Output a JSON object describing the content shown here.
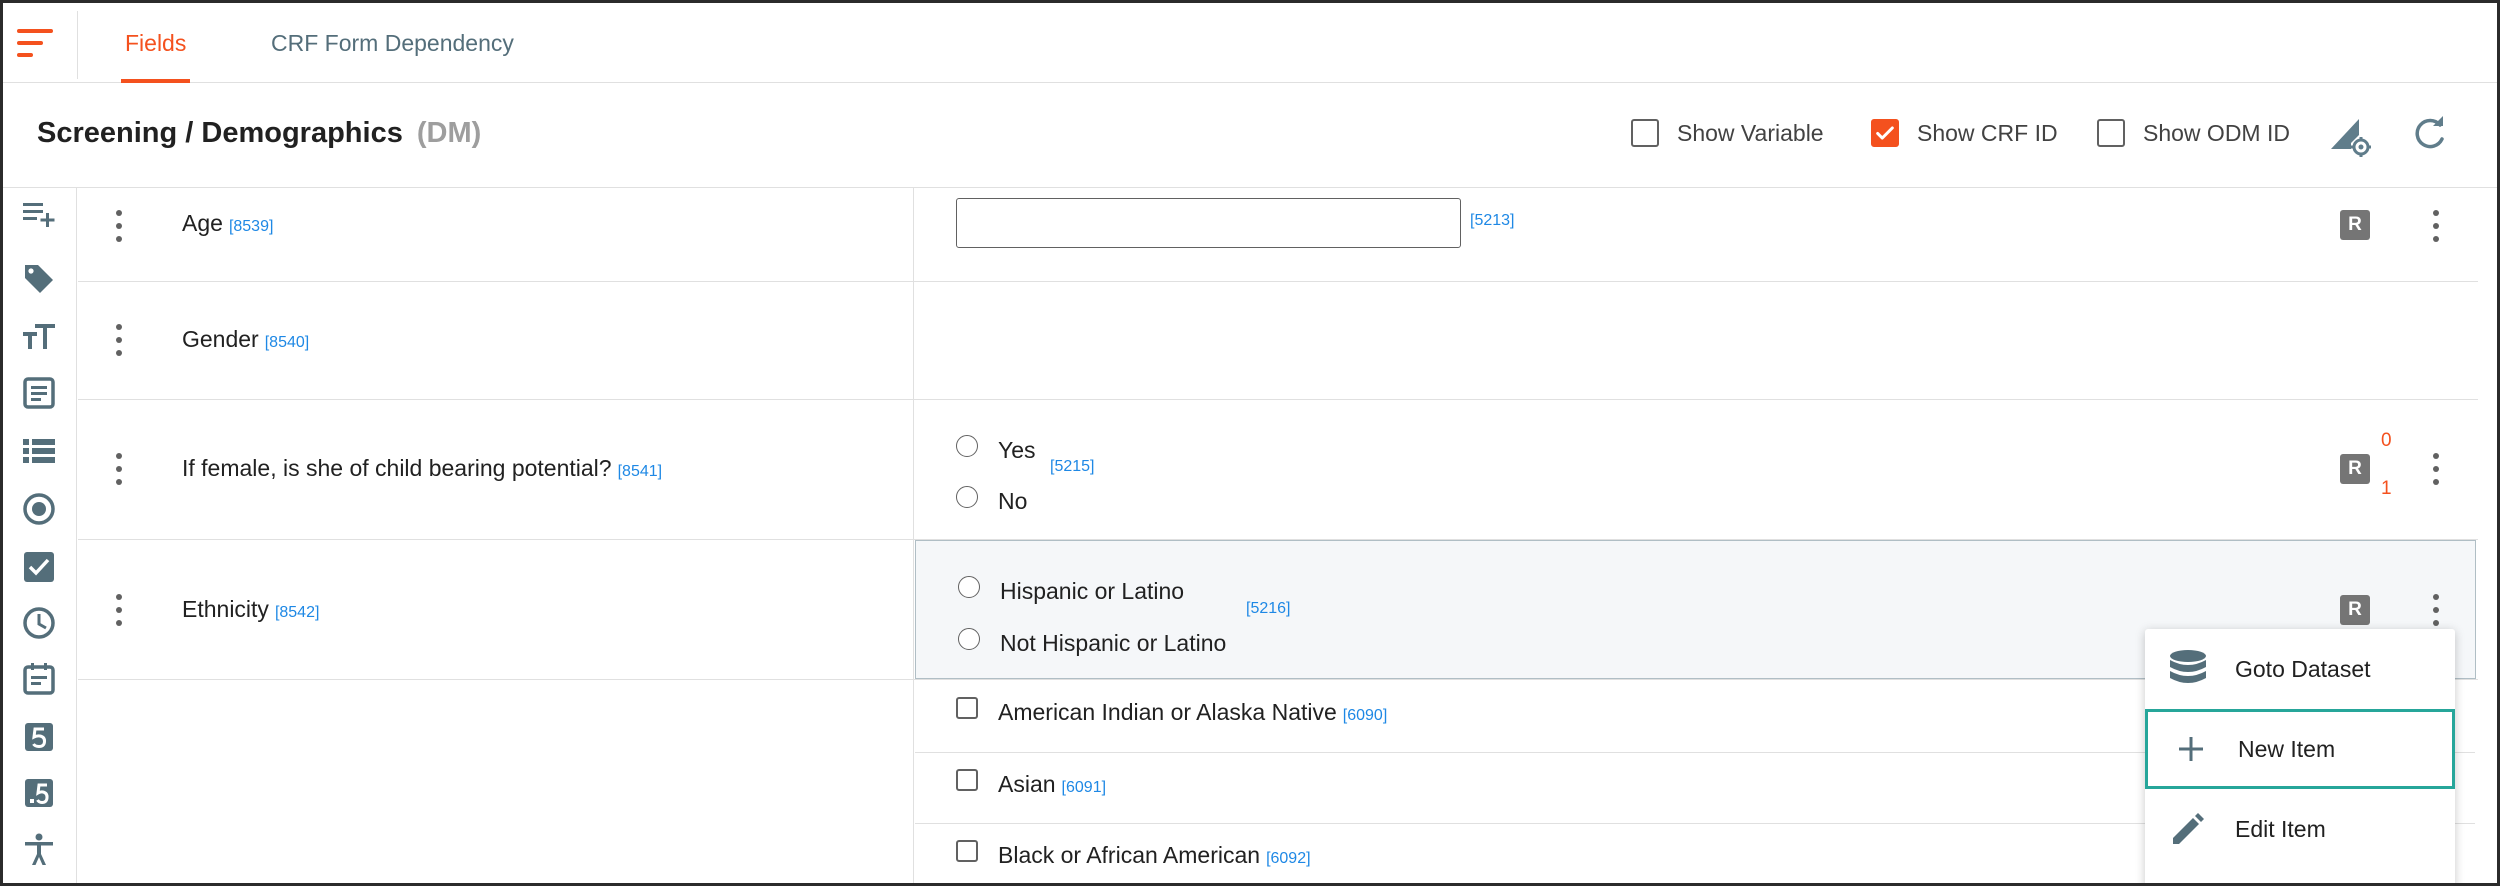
{
  "tabs": [
    {
      "label": "Fields",
      "active": true
    },
    {
      "label": "CRF Form Dependency",
      "active": false
    }
  ],
  "header": {
    "title": "Screening / Demographics",
    "form_code": "(DM)",
    "options": [
      {
        "label": "Show Variable",
        "checked": false
      },
      {
        "label": "Show CRF ID",
        "checked": true
      },
      {
        "label": "Show ODM ID",
        "checked": false
      }
    ]
  },
  "sidebar": {
    "icons": [
      "add-list-icon",
      "tag-icon",
      "text-size-icon",
      "note-icon",
      "list-icon",
      "radio-icon",
      "checkbox-icon",
      "clock-icon",
      "calendar-icon",
      "number-5-icon",
      "decimal-icon",
      "accessibility-icon"
    ]
  },
  "rows": [
    {
      "label": "Age",
      "crf_id": "[8539]",
      "answer_type": "text",
      "answer_id": "[5213]",
      "badge": "R"
    },
    {
      "label": "Gender",
      "crf_id": "[8540]"
    },
    {
      "label": "If female, is she of child bearing potential?",
      "crf_id": "[8541]",
      "answer_type": "radio",
      "options": [
        "Yes",
        "No"
      ],
      "answer_id": "[5215]",
      "badge": "R",
      "counts": [
        "0",
        "1"
      ]
    },
    {
      "label": "Ethnicity",
      "crf_id": "[8542]",
      "answer_type": "radio",
      "options": [
        "Hispanic or Latino",
        "Not Hispanic or Latino"
      ],
      "answer_id": "[5216]",
      "badge": "R"
    }
  ],
  "checkbox_items": [
    {
      "label": "American Indian or Alaska Native",
      "id": "[6090]"
    },
    {
      "label": "Asian",
      "id": "[6091]"
    },
    {
      "label": "Black or African American",
      "id": "[6092]"
    }
  ],
  "context_menu": {
    "items": [
      {
        "label": "Goto Dataset",
        "icon": "database-icon"
      },
      {
        "label": "New Item",
        "icon": "plus-icon",
        "focused": true
      },
      {
        "label": "Edit Item",
        "icon": "pencil-icon"
      }
    ]
  },
  "colors": {
    "accent": "#f4511e",
    "link_id": "#1e88e5",
    "focus": "#26a69a",
    "tab_inactive": "#546e7a"
  }
}
